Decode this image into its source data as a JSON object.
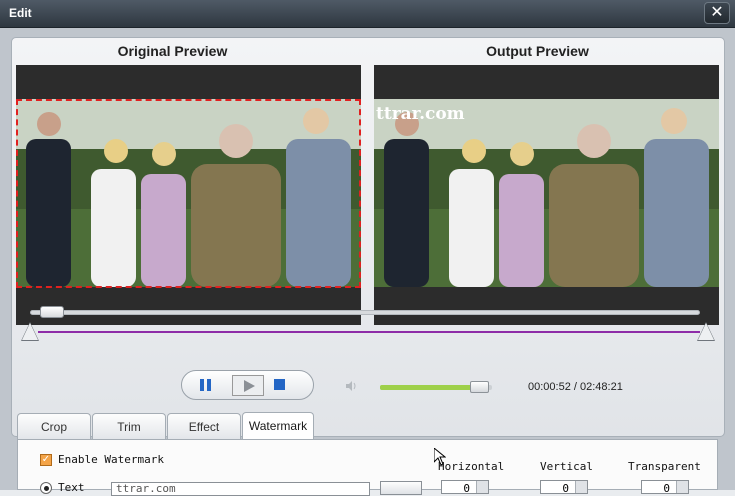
{
  "window": {
    "title": "Edit",
    "close_label": "✕"
  },
  "previews": {
    "original_label": "Original Preview",
    "output_label": "Output Preview",
    "watermark_overlay": "ttrar.com"
  },
  "playback": {
    "time_current": "00:00:52",
    "time_total": "02:48:21",
    "time_display": "00:00:52 / 02:48:21",
    "seek_position": 0.02,
    "volume_level": 0.82,
    "range_start": 0.0,
    "range_end": 1.0
  },
  "tabs": [
    {
      "label": "Crop"
    },
    {
      "label": "Trim"
    },
    {
      "label": "Effect"
    },
    {
      "label": "Watermark",
      "active": true
    }
  ],
  "watermark": {
    "enable_label": "Enable Watermark",
    "enabled": true,
    "text_option_label": "Text",
    "text_value": "ttrar.com",
    "horizontal_label": "Horizontal",
    "vertical_label": "Vertical",
    "transparent_label": "Transparent",
    "horizontal_value": "0",
    "vertical_value": "0",
    "transparent_value": "0"
  },
  "colors": {
    "accent_blue": "#2366c5",
    "crop_border": "#e02020",
    "range_line": "#8e2ca8",
    "volume_fill": "#9ed04a",
    "checkbox": "#f4a448"
  }
}
